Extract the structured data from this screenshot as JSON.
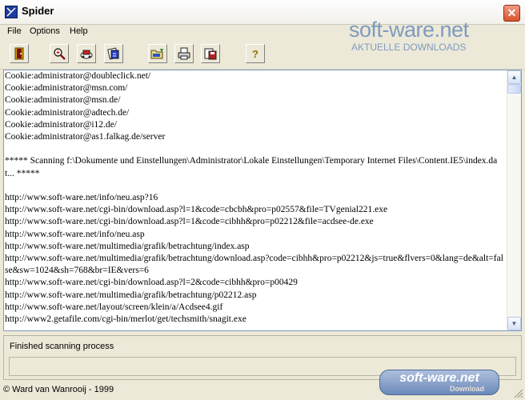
{
  "window": {
    "title": "Spider",
    "close_label": "✕"
  },
  "menu": [
    "File",
    "Options",
    "Help"
  ],
  "toolbar": {
    "buttons": [
      {
        "name": "exit-icon",
        "label": "Exit"
      },
      {
        "name": "zoom-icon",
        "label": "Search"
      },
      {
        "name": "cookie-scan-icon",
        "label": "Scan cookies"
      },
      {
        "name": "history-icon",
        "label": "History"
      },
      {
        "name": "open-folder-icon",
        "label": "Open"
      },
      {
        "name": "print-icon",
        "label": "Print"
      },
      {
        "name": "save-icon",
        "label": "Save"
      },
      {
        "name": "help-icon",
        "label": "?"
      }
    ]
  },
  "logo": {
    "main": "soft-ware.net",
    "sub": "AKTUELLE DOWNLOADS"
  },
  "log": {
    "lines": [
      "Cookie:administrator@doubleclick.net/",
      "Cookie:administrator@msn.com/",
      "Cookie:administrator@msn.de/",
      "Cookie:administrator@adtech.de/",
      "Cookie:administrator@i12.de/",
      "Cookie:administrator@as1.falkag.de/server",
      "",
      "***** Scanning f:\\Dokumente und Einstellungen\\Administrator\\Lokale Einstellungen\\Temporary Internet Files\\Content.IE5\\index.dat... *****",
      "",
      "http://www.soft-ware.net/info/neu.asp?16",
      "http://www.soft-ware.net/cgi-bin/download.asp?l=1&code=cbcbh&pro=p02557&file=TVgenial221.exe",
      "http://www.soft-ware.net/cgi-bin/download.asp?l=1&code=cibhh&pro=p02212&file=acdsee-de.exe",
      "http://www.soft-ware.net/info/neu.asp",
      "http://www.soft-ware.net/multimedia/grafik/betrachtung/index.asp",
      "http://www.soft-ware.net/multimedia/grafik/betrachtung/download.asp?code=cibhh&pro=p02212&js=true&flvers=0&lang=de&alt=false&sw=1024&sh=768&br=IE&vers=6",
      "http://www.soft-ware.net/cgi-bin/download.asp?l=2&code=cibhh&pro=p00429",
      "http://www.soft-ware.net/multimedia/grafik/betrachtung/p02212.asp",
      "http://www.soft-ware.net/layout/screen/klein/a/Acdsee4.gif",
      "http://www2.getafile.com/cgi-bin/merlot/get/techsmith/snagit.exe"
    ]
  },
  "status": {
    "text": "Finished scanning process",
    "progress": 0
  },
  "footer": {
    "copyright": "© Ward van Wanrooij - 1999",
    "logo_main": "soft-ware.net",
    "logo_sub": "Download"
  }
}
